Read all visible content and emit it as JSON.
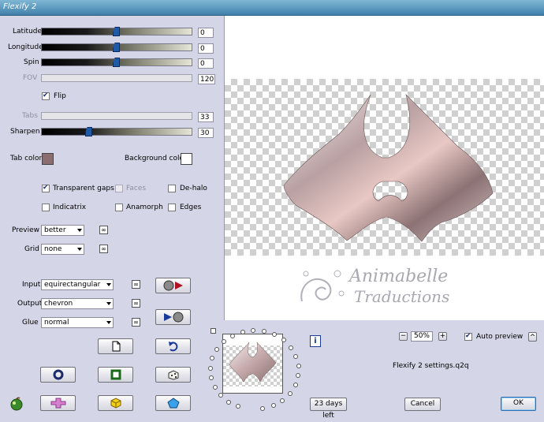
{
  "window": {
    "title": "Flexify 2"
  },
  "sliders": {
    "latitude": {
      "label": "Latitude",
      "value": "0"
    },
    "longitude": {
      "label": "Longitude",
      "value": "0"
    },
    "spin": {
      "label": "Spin",
      "value": "0"
    },
    "fov": {
      "label": "FOV",
      "value": "120"
    },
    "tabs": {
      "label": "Tabs",
      "value": "33"
    },
    "sharpen": {
      "label": "Sharpen",
      "value": "30"
    }
  },
  "flip": {
    "label": "Flip",
    "checked": true
  },
  "colors": {
    "tab_label": "Tab color",
    "tab_color": "#8a6e70",
    "bg_label": "Background color",
    "bg_color": "#ffffff"
  },
  "options": {
    "transparent_gaps": "Transparent gaps",
    "faces": "Faces",
    "de_halo": "De-halo",
    "indicatrix": "Indicatrix",
    "anamorph": "Anamorph",
    "edges": "Edges"
  },
  "preview_select": {
    "label": "Preview",
    "value": "better"
  },
  "grid_select": {
    "label": "Grid",
    "value": "none"
  },
  "input_select": {
    "label": "Input",
    "value": "equirectangular"
  },
  "output_select": {
    "label": "Output",
    "value": "chevron"
  },
  "glue_select": {
    "label": "Glue",
    "value": "normal"
  },
  "link_glyph": "∞",
  "zoom": {
    "minus": "−",
    "value": "50%",
    "plus": "+"
  },
  "auto_preview": {
    "label": "Auto preview",
    "checked": true
  },
  "settings_file": "Flexify 2 settings.q2q",
  "trial": "23 days left",
  "buttons": {
    "cancel": "Cancel",
    "ok": "OK",
    "info": "i",
    "up": "^"
  },
  "watermark": {
    "line1": "Animabelle",
    "line2": "Traductions"
  }
}
